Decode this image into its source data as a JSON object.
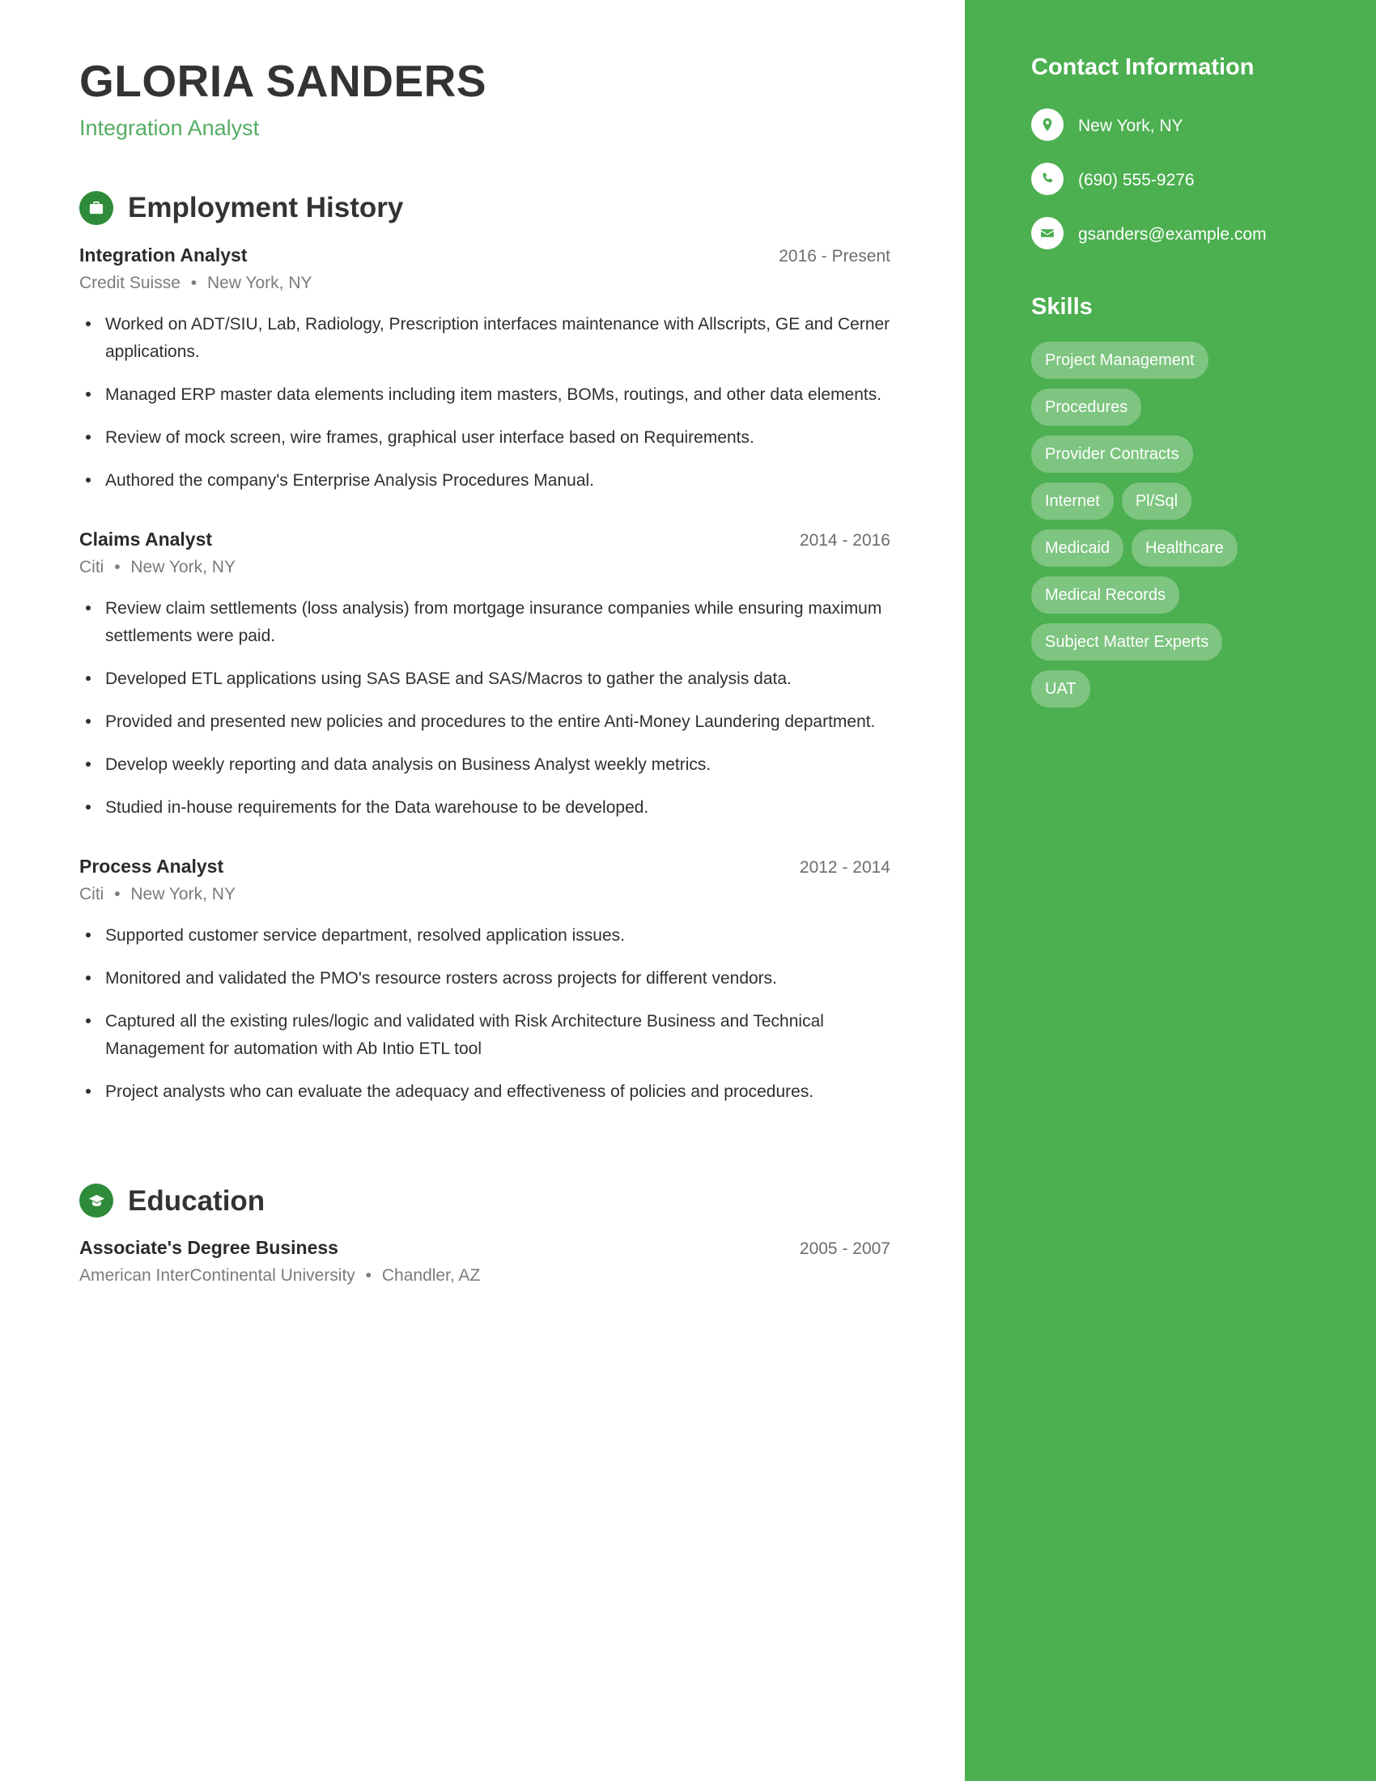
{
  "header": {
    "name": "GLORIA SANDERS",
    "job_title": "Integration Analyst"
  },
  "theme": {
    "sidebar_green": "#4CAF50",
    "icon_green": "#2e8b3a",
    "accent_text_green": "#55ad63",
    "pill_bg": "rgba(255,255,255,0.28)"
  },
  "sections": {
    "employment": {
      "title": "Employment History",
      "icon": "briefcase-icon",
      "entries": [
        {
          "role": "Integration Analyst",
          "dates": "2016 - Present",
          "company": "Credit Suisse",
          "location": "New York, NY",
          "bullets": [
            "Worked on ADT/SIU, Lab, Radiology, Prescription interfaces maintenance with Allscripts, GE and Cerner applications.",
            "Managed ERP master data elements including item masters, BOMs, routings, and other data elements.",
            "Review of mock screen, wire frames, graphical user interface based on Requirements.",
            "Authored the company's Enterprise Analysis Procedures Manual."
          ]
        },
        {
          "role": "Claims Analyst",
          "dates": "2014 - 2016",
          "company": "Citi",
          "location": "New York, NY",
          "bullets": [
            "Review claim settlements (loss analysis) from mortgage insurance companies while ensuring maximum settlements were paid.",
            "Developed ETL applications using SAS BASE and SAS/Macros to gather the analysis data.",
            "Provided and presented new policies and procedures to the entire Anti-Money Laundering department.",
            "Develop weekly reporting and data analysis on Business Analyst weekly metrics.",
            "Studied in-house requirements for the Data warehouse to be developed."
          ]
        },
        {
          "role": "Process Analyst",
          "dates": "2012 - 2014",
          "company": "Citi",
          "location": "New York, NY",
          "bullets": [
            "Supported customer service department, resolved application issues.",
            "Monitored and validated the PMO's resource rosters across projects for different vendors.",
            "Captured all the existing rules/logic and validated with Risk Architecture Business and Technical Management for automation with Ab Intio ETL tool",
            "Project analysts who can evaluate the adequacy and effectiveness of policies and procedures."
          ]
        }
      ]
    },
    "education": {
      "title": "Education",
      "icon": "graduation-cap-icon",
      "entries": [
        {
          "degree": "Associate's Degree Business",
          "dates": "2005 - 2007",
          "school": "American InterContinental University",
          "location": "Chandler, AZ"
        }
      ]
    }
  },
  "sidebar": {
    "contact": {
      "title": "Contact Information",
      "items": [
        {
          "icon": "location-pin-icon",
          "value": "New York, NY"
        },
        {
          "icon": "phone-icon",
          "value": "(690) 555-9276"
        },
        {
          "icon": "envelope-icon",
          "value": "gsanders@example.com"
        }
      ]
    },
    "skills": {
      "title": "Skills",
      "items": [
        "Project Management",
        "Procedures",
        "Provider Contracts",
        "Internet",
        "Pl/Sql",
        "Medicaid",
        "Healthcare",
        "Medical Records",
        "Subject Matter Experts",
        "UAT"
      ]
    }
  },
  "separators": {
    "bullet_dot": "•"
  }
}
